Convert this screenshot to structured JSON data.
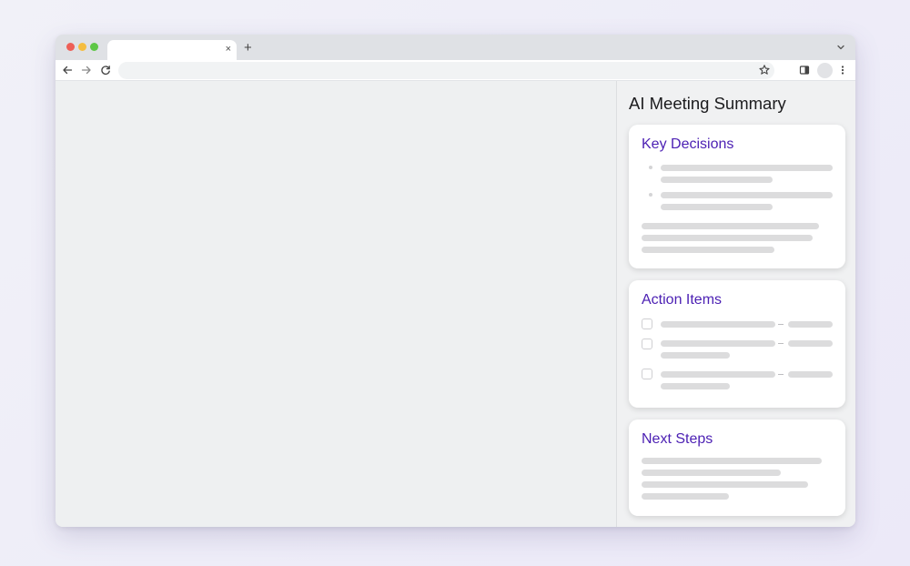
{
  "browser": {
    "tab_close_glyph": "×",
    "new_tab_glyph": "+",
    "icons": [
      "back-arrow-icon",
      "forward-arrow-icon",
      "reload-icon",
      "bookmark-star-icon",
      "side-panel-icon",
      "profile-avatar",
      "more-menu-icon",
      "tab-list-chevron-icon"
    ]
  },
  "sidepanel": {
    "title": "AI Meeting Summary",
    "cards": {
      "key_decisions": {
        "title": "Key Decisions"
      },
      "action_items": {
        "title": "Action Items"
      },
      "next_steps": {
        "title": "Next Steps"
      }
    }
  },
  "colors": {
    "card_title": "#4b1fb3",
    "placeholder_bar": "#dcdcdd",
    "traffic_red": "#ee5f57",
    "traffic_yellow": "#f5bd3f",
    "traffic_green": "#5ec746"
  }
}
